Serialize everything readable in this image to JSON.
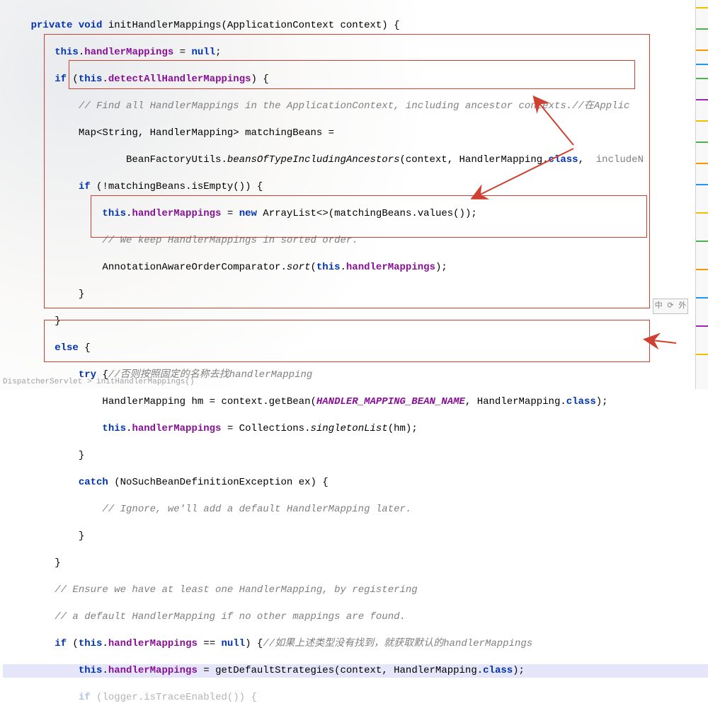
{
  "code": {
    "l1": {
      "kw1": "private void",
      "name": " initHandlerMappings(ApplicationContext context) {"
    },
    "l2": {
      "kw1": "this",
      "dot": ".",
      "f1": "handlerMappings",
      "rest": " = ",
      "kw2": "null",
      "semi": ";"
    },
    "l3": {
      "kw1": "if",
      "p1": " (",
      "kw2": "this",
      "dot": ".",
      "f1": "detectAllHandlerMappings",
      "p2": ") {"
    },
    "l4": {
      "c": "// Find all HandlerMappings in the ApplicationContext, including ancestor contexts.",
      "c2": "//在Applic"
    },
    "l5": {
      "t1": "Map<String, HandlerMapping> matchingBeans ="
    },
    "l6": {
      "t1": "BeanFactoryUtils.",
      "m1": "beansOfTypeIncludingAncestors",
      "t2": "(context, HandlerMapping.",
      "kw1": "class",
      "t3": ",",
      "hint": "  includeN"
    },
    "l7": {
      "kw1": "if",
      "t1": " (!matchingBeans.isEmpty()) {"
    },
    "l8": {
      "kw1": "this",
      "dot": ".",
      "f1": "handlerMappings",
      "t1": " = ",
      "kw2": "new",
      "t2": " ArrayList<>(matchingBeans.values());"
    },
    "l9": {
      "c": "// We keep HandlerMappings in sorted order."
    },
    "l10": {
      "t1": "AnnotationAwareOrderComparator.",
      "m1": "sort",
      "t2": "(",
      "kw1": "this",
      "dot": ".",
      "f1": "handlerMappings",
      "t3": ");"
    },
    "l11": {
      "t": "}"
    },
    "l12": {
      "t": "}"
    },
    "l13": {
      "kw1": "else",
      "t": " {"
    },
    "l14": {
      "kw1": "try",
      "t": " {",
      "c": "//否则按照固定的名称去找handlerMapping"
    },
    "l15": {
      "t1": "HandlerMapping hm = context.getBean(",
      "c1": "HANDLER_MAPPING_BEAN_NAME",
      "t2": ", HandlerMapping.",
      "kw1": "class",
      "t3": ");"
    },
    "l16": {
      "kw1": "this",
      "dot": ".",
      "f1": "handlerMappings",
      "t1": " = Collections.",
      "m1": "singletonList",
      "t2": "(hm);"
    },
    "l17": {
      "t": "}"
    },
    "l18": {
      "kw1": "catch",
      "t": " (NoSuchBeanDefinitionException ex) {"
    },
    "l19": {
      "c": "// Ignore, we'll add a default HandlerMapping later."
    },
    "l20": {
      "t": "}"
    },
    "l21": {
      "t": "}"
    },
    "l22": {
      "c": "// Ensure we have at least one HandlerMapping, by registering"
    },
    "l23": {
      "c": "// a default HandlerMapping if no other mappings are found."
    },
    "l24": {
      "kw1": "if",
      "t1": " (",
      "kw2": "this",
      "dot": ".",
      "f1": "handlerMappings",
      "t2": " == ",
      "kw3": "null",
      "t3": ") {",
      "c": "//如果上述类型没有找到，就获取默认的handlerMappings"
    },
    "l25": {
      "kw1": "this",
      "dot": ".",
      "f1": "handlerMappings",
      "t1": " = getDefaultStrategies(context, HandlerMapping.",
      "kw2": "class",
      "t2": ");"
    },
    "l26": {
      "kw1": "if",
      "t1": " (logger.isTraceEnabled()) {"
    }
  },
  "status": "DispatcherServlet  >  initHandlerMappings()",
  "toolbox": "中 ⟳ 外"
}
